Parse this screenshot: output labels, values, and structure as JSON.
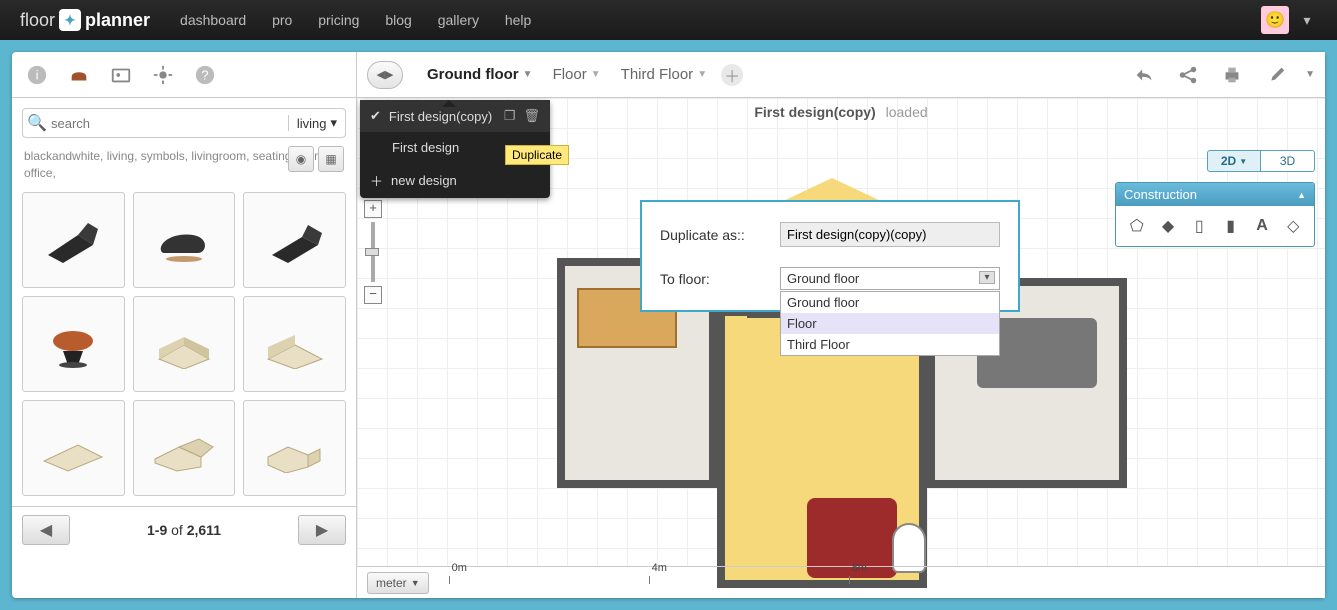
{
  "brand": {
    "part1": "floor",
    "part2": "planner"
  },
  "topnav": {
    "dashboard": "dashboard",
    "pro": "pro",
    "pricing": "pricing",
    "blog": "blog",
    "gallery": "gallery",
    "help": "help"
  },
  "search": {
    "placeholder": "search",
    "category": "living"
  },
  "tags": "blackandwhite, living, symbols, livingroom, seating, lounge, office,",
  "pager": {
    "range": "1-9",
    "of": "of",
    "total": "2,611"
  },
  "floors": {
    "ground": "Ground floor",
    "floor": "Floor",
    "third": "Third Floor"
  },
  "canvas": {
    "title": "First design(copy)",
    "status": "loaded"
  },
  "designMenu": {
    "item1": "First design(copy)",
    "item2": "First design",
    "item3": "new design",
    "tooltip": "Duplicate"
  },
  "dialog": {
    "label1": "Duplicate as::",
    "value1": "First design(copy)(copy)",
    "label2": "To floor:",
    "selected": "Ground floor",
    "opt1": "Ground floor",
    "opt2": "Floor",
    "opt3": "Third Floor"
  },
  "viewmode": {
    "two": "2D",
    "three": "3D"
  },
  "construction": {
    "title": "Construction"
  },
  "ruler": {
    "unit": "meter",
    "t0": "0m",
    "t4": "4m",
    "t8": "8m"
  }
}
